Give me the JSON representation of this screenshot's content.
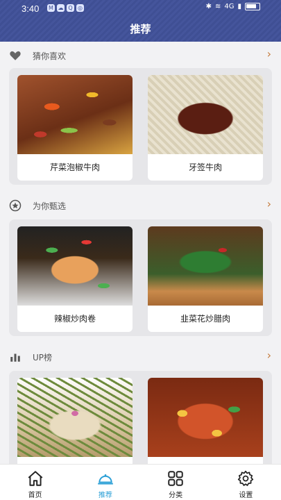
{
  "status_bar": {
    "time": "3:40",
    "network": "4G",
    "notif_icons": [
      "M",
      "☁",
      "Q",
      "◎"
    ]
  },
  "header": {
    "title": "推荐",
    "color": "#3f4f94"
  },
  "sections": [
    {
      "title": "猜你喜欢",
      "icon": "heart-icon",
      "arrow": "›",
      "items": [
        {
          "label": "芹菜泡椒牛肉"
        },
        {
          "label": "牙签牛肉"
        }
      ]
    },
    {
      "title": "为你甄选",
      "icon": "star-badge-icon",
      "arrow": "›",
      "items": [
        {
          "label": "辣椒炒肉卷"
        },
        {
          "label": "韭菜花炒腊肉"
        }
      ]
    },
    {
      "title": "UP榜",
      "icon": "bar-chart-icon",
      "arrow": "›",
      "items": [
        {
          "label": ""
        },
        {
          "label": ""
        }
      ]
    }
  ],
  "tabbar": {
    "active_color": "#2a9fd6",
    "items": [
      {
        "label": "首页",
        "icon": "home-icon"
      },
      {
        "label": "推荐",
        "icon": "cloche-icon"
      },
      {
        "label": "分类",
        "icon": "grid-icon"
      },
      {
        "label": "设置",
        "icon": "gear-icon"
      }
    ]
  }
}
